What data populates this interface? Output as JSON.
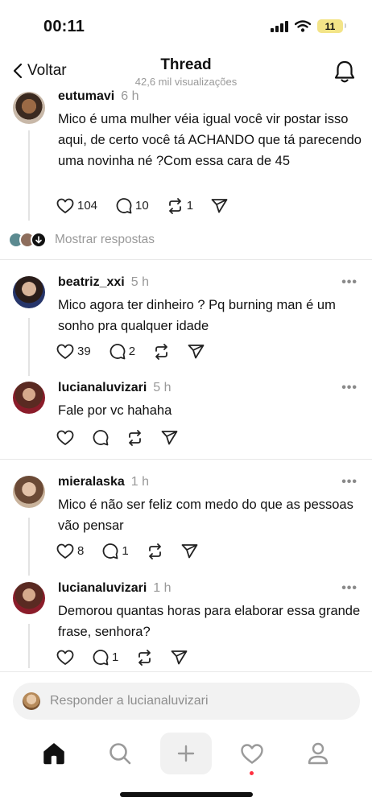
{
  "status": {
    "time": "00:11",
    "battery": "11"
  },
  "header": {
    "back_label": "Voltar",
    "title": "Thread",
    "subtitle": "42,6 mil visualizações"
  },
  "posts": [
    {
      "username": "eutumavi",
      "time": "6 h",
      "text": "Mico é uma mulher véia igual você vir postar isso aqui, de certo você tá ACHANDO que tá parecendo uma novinha né ?Com essa cara de 45",
      "likes": "104",
      "replies": "10",
      "reposts": "1"
    },
    {
      "username": "beatriz_xxi",
      "time": "5 h",
      "text": "Mico agora ter dinheiro ? Pq burning man é um sonho pra qualquer idade",
      "likes": "39",
      "replies": "2",
      "reposts": ""
    },
    {
      "username": "lucianaluvizari",
      "time": "5 h",
      "text": "Fale por vc hahaha",
      "likes": "",
      "replies": "",
      "reposts": ""
    },
    {
      "username": "mieralaska",
      "time": "1 h",
      "text": "Mico é não ser feliz com medo do que as pessoas vão pensar",
      "likes": "8",
      "replies": "1",
      "reposts": ""
    },
    {
      "username": "lucianaluvizari",
      "time": "1 h",
      "text": "Demorou quantas horas para elaborar essa grande frase, senhora?",
      "likes": "",
      "replies": "1",
      "reposts": ""
    }
  ],
  "show_replies_label": "Mostrar respostas",
  "more_label": "•••",
  "reply_bar": {
    "placeholder": "Responder a lucianaluvizari"
  },
  "tabs": [
    {
      "icon": "home-icon"
    },
    {
      "icon": "search-icon"
    },
    {
      "icon": "plus-icon"
    },
    {
      "icon": "heart-icon",
      "has_notification": true
    },
    {
      "icon": "profile-icon"
    }
  ],
  "colors": {
    "accent_dot": "#ff3040",
    "muted": "#999999",
    "battery": "#f3e488"
  }
}
